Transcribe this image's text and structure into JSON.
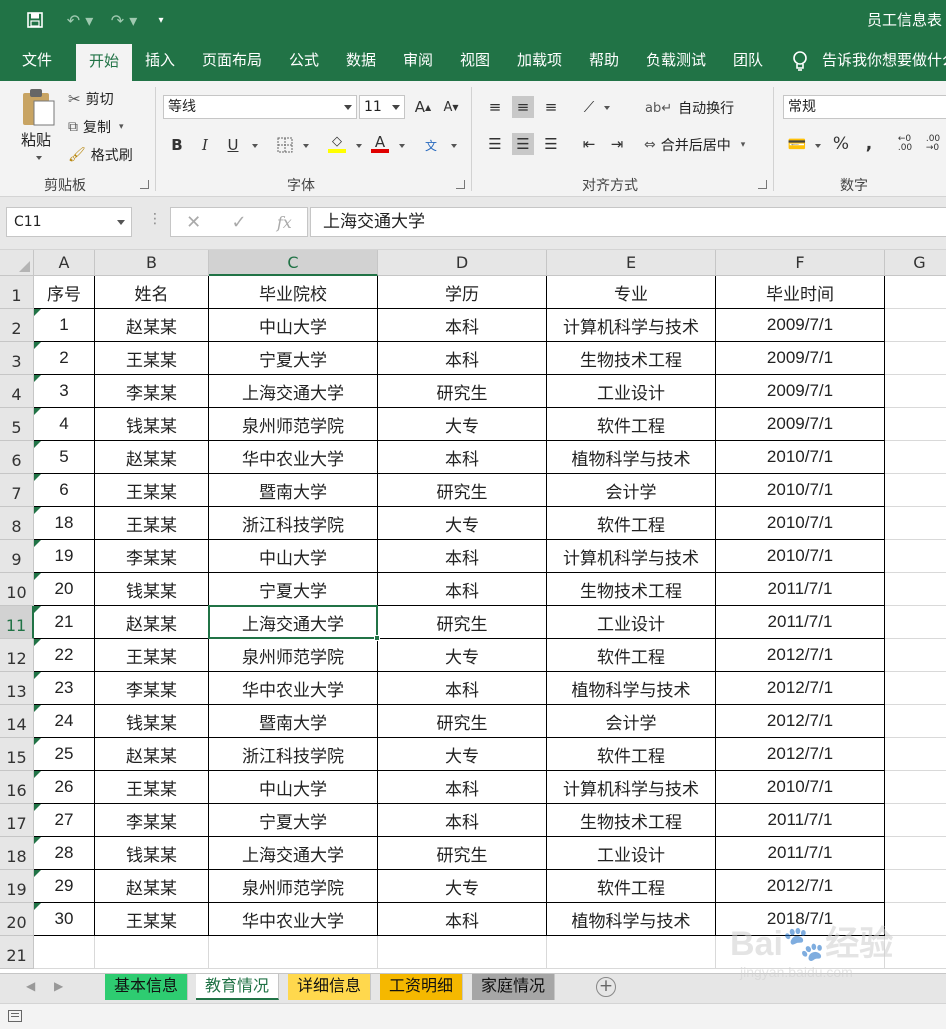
{
  "window": {
    "title": "员工信息表",
    "quick_access": {
      "save": "save-icon",
      "undo": "undo-icon",
      "redo": "redo-icon",
      "customize": "customize-icon"
    }
  },
  "tabs": [
    {
      "label": "文件",
      "active": false
    },
    {
      "label": "开始",
      "active": true
    },
    {
      "label": "插入",
      "active": false
    },
    {
      "label": "页面布局",
      "active": false
    },
    {
      "label": "公式",
      "active": false
    },
    {
      "label": "数据",
      "active": false
    },
    {
      "label": "审阅",
      "active": false
    },
    {
      "label": "视图",
      "active": false
    },
    {
      "label": "加载项",
      "active": false
    },
    {
      "label": "帮助",
      "active": false
    },
    {
      "label": "负载测试",
      "active": false
    },
    {
      "label": "团队",
      "active": false
    }
  ],
  "tellme": "告诉我你想要做什么",
  "ribbon": {
    "clipboard": {
      "paste": "粘贴",
      "cut": "剪切",
      "copy": "复制",
      "format_painter": "格式刷",
      "label": "剪贴板"
    },
    "font": {
      "name": "等线",
      "size": "11",
      "bold": "B",
      "italic": "I",
      "underline": "U",
      "label": "字体",
      "fill_color": "#ffff00",
      "font_color": "#e00000"
    },
    "alignment": {
      "wrap_text": "自动换行",
      "merge_center": "合并后居中",
      "label": "对齐方式"
    },
    "number": {
      "format": "常规",
      "percent": "%",
      "comma": ",",
      "label": "数字"
    }
  },
  "formula_bar": {
    "name_box": "C11",
    "formula": "上海交通大学"
  },
  "columns": [
    "A",
    "B",
    "C",
    "D",
    "E",
    "F",
    "G"
  ],
  "selected_column": "C",
  "selected_row": 11,
  "header_row": [
    "序号",
    "姓名",
    "毕业院校",
    "学历",
    "专业",
    "毕业时间"
  ],
  "rows": [
    [
      "1",
      "赵某某",
      "中山大学",
      "本科",
      "计算机科学与技术",
      "2009/7/1"
    ],
    [
      "2",
      "王某某",
      "宁夏大学",
      "本科",
      "生物技术工程",
      "2009/7/1"
    ],
    [
      "3",
      "李某某",
      "上海交通大学",
      "研究生",
      "工业设计",
      "2009/7/1"
    ],
    [
      "4",
      "钱某某",
      "泉州师范学院",
      "大专",
      "软件工程",
      "2009/7/1"
    ],
    [
      "5",
      "赵某某",
      "华中农业大学",
      "本科",
      "植物科学与技术",
      "2010/7/1"
    ],
    [
      "6",
      "王某某",
      "暨南大学",
      "研究生",
      "会计学",
      "2010/7/1"
    ],
    [
      "18",
      "王某某",
      "浙江科技学院",
      "大专",
      "软件工程",
      "2010/7/1"
    ],
    [
      "19",
      "李某某",
      "中山大学",
      "本科",
      "计算机科学与技术",
      "2010/7/1"
    ],
    [
      "20",
      "钱某某",
      "宁夏大学",
      "本科",
      "生物技术工程",
      "2011/7/1"
    ],
    [
      "21",
      "赵某某",
      "上海交通大学",
      "研究生",
      "工业设计",
      "2011/7/1"
    ],
    [
      "22",
      "王某某",
      "泉州师范学院",
      "大专",
      "软件工程",
      "2012/7/1"
    ],
    [
      "23",
      "李某某",
      "华中农业大学",
      "本科",
      "植物科学与技术",
      "2012/7/1"
    ],
    [
      "24",
      "钱某某",
      "暨南大学",
      "研究生",
      "会计学",
      "2012/7/1"
    ],
    [
      "25",
      "赵某某",
      "浙江科技学院",
      "大专",
      "软件工程",
      "2012/7/1"
    ],
    [
      "26",
      "王某某",
      "中山大学",
      "本科",
      "计算机科学与技术",
      "2010/7/1"
    ],
    [
      "27",
      "李某某",
      "宁夏大学",
      "本科",
      "生物技术工程",
      "2011/7/1"
    ],
    [
      "28",
      "钱某某",
      "上海交通大学",
      "研究生",
      "工业设计",
      "2011/7/1"
    ],
    [
      "29",
      "赵某某",
      "泉州师范学院",
      "大专",
      "软件工程",
      "2012/7/1"
    ],
    [
      "30",
      "王某某",
      "华中农业大学",
      "本科",
      "植物科学与技术",
      "2018/7/1"
    ]
  ],
  "row_numbers": [
    "1",
    "2",
    "3",
    "4",
    "5",
    "6",
    "7",
    "8",
    "9",
    "10",
    "11",
    "12",
    "13",
    "14",
    "15",
    "16",
    "17",
    "18",
    "19",
    "20",
    "21"
  ],
  "sheets": [
    {
      "label": "基本信息",
      "color": "#2ecc71",
      "active": false
    },
    {
      "label": "教育情况",
      "color": "#ffffff",
      "active": true
    },
    {
      "label": "详细信息",
      "color": "#ffd84d",
      "active": false
    },
    {
      "label": "工资明细",
      "color": "#f5b800",
      "active": false
    },
    {
      "label": "家庭情况",
      "color": "#a6a6a6",
      "active": false
    }
  ],
  "watermark": {
    "brand": "Bai",
    "brand2": "经验",
    "url": "jingyan.baidu.com"
  }
}
